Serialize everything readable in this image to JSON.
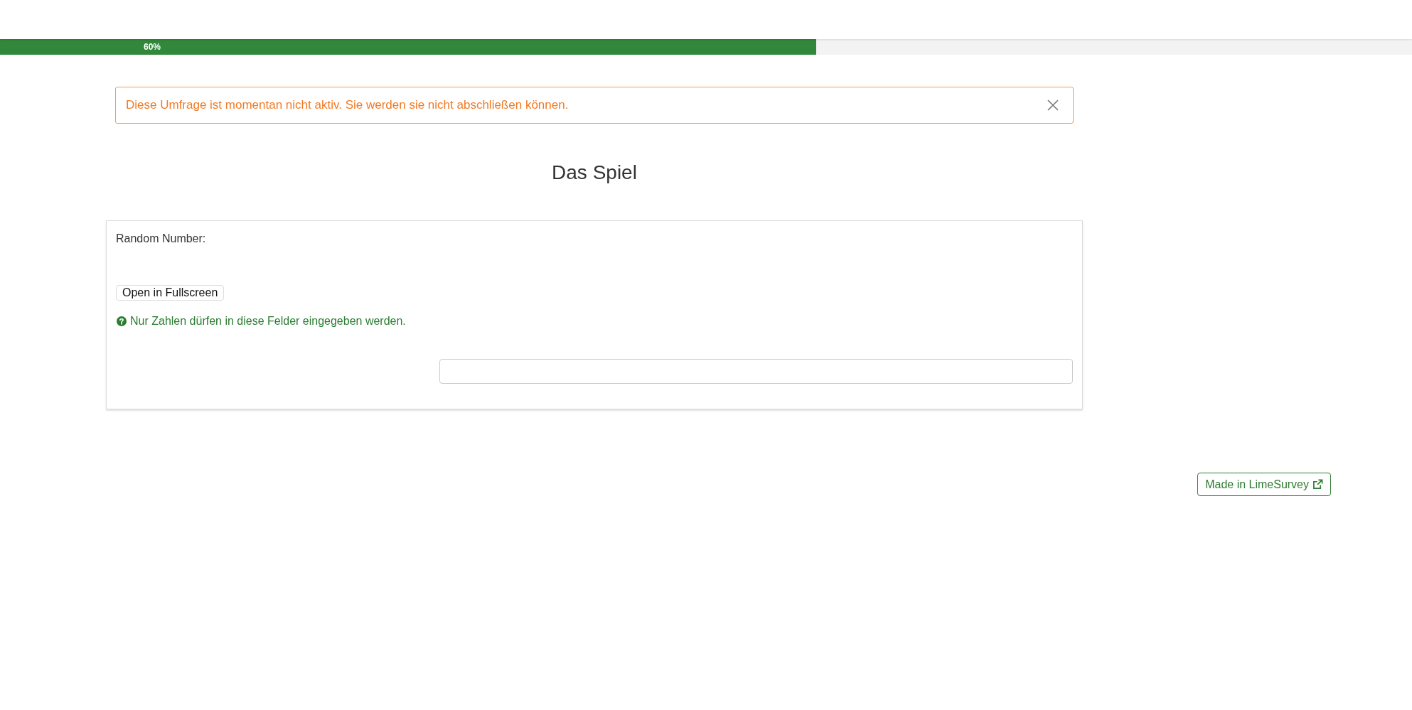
{
  "progress": {
    "level": 0.578,
    "label": "60%"
  },
  "alert": {
    "message": "Diese Umfrage ist momentan nicht aktiv. Sie werden sie nicht abschließen können.",
    "dismissible": true
  },
  "survey": {
    "title": "Das Spiel"
  },
  "question": {
    "text": "Random Number:",
    "button": "Open in Fullscreen",
    "help": "Nur Zahlen dürfen in diese Felder eingegeben werden."
  },
  "footer": {
    "link": "Made in LimeSurvey"
  }
}
